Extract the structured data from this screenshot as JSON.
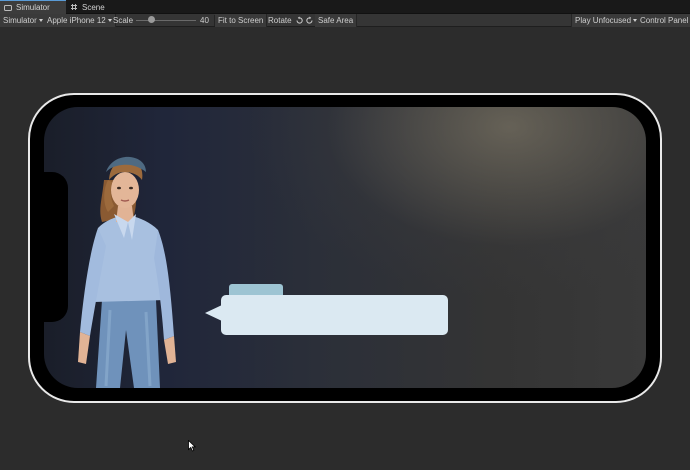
{
  "tabs": [
    {
      "label": "Simulator",
      "icon": "simulator-icon",
      "active": true
    },
    {
      "label": "Scene",
      "icon": "scene-grid-icon",
      "active": false
    }
  ],
  "toolbar": {
    "simulator_dropdown": "Simulator",
    "device_dropdown": "Apple iPhone 12",
    "scale_label": "Scale",
    "scale_value": "40",
    "scale_fraction": 0.25,
    "fit_to_screen": "Fit to Screen",
    "rotate_label": "Rotate",
    "safe_area": "Safe Area",
    "play_mode_dropdown": "Play Unfocused",
    "control_panel": "Control Panel"
  },
  "colors": {
    "editor_background": "#2c2c2c",
    "device_bezel": "#e9e9e9",
    "speech_bubble": "#dbe9f2",
    "speech_bubble_tab": "#9dc4d3"
  }
}
